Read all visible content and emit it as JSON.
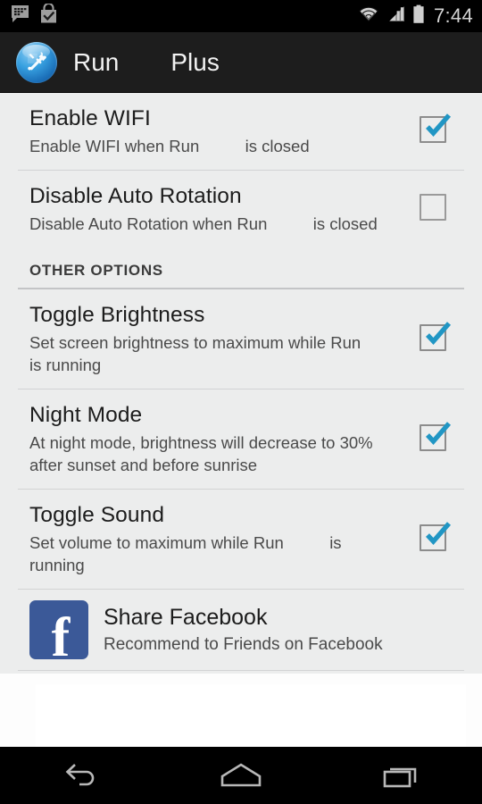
{
  "status_bar": {
    "time": "7:44",
    "left_icons": [
      "bbm-chat-icon",
      "play-store-bag-icon"
    ],
    "right_icons": [
      "wifi-icon",
      "cellular-signal-icon",
      "battery-icon"
    ]
  },
  "action_bar": {
    "app_icon": "wrench-tool-icon",
    "title": "Run",
    "title_secondary": "Plus"
  },
  "settings": {
    "rows": [
      {
        "title": "Enable WIFI",
        "summary": "Enable WIFI when Run          is closed",
        "checked": true
      },
      {
        "title": "Disable Auto Rotation",
        "summary": "Disable Auto Rotation when Run          is closed",
        "checked": false
      }
    ],
    "section_header": "OTHER OPTIONS",
    "other_rows": [
      {
        "title": "Toggle Brightness",
        "summary": "Set screen brightness to maximum while Run          is running",
        "checked": true
      },
      {
        "title": "Night Mode",
        "summary": "At night mode, brightness will decrease to 30% after sunset and before sunrise",
        "checked": true
      },
      {
        "title": "Toggle Sound",
        "summary": "Set volume to maximum while Run          is running",
        "checked": true
      }
    ],
    "facebook": {
      "icon": "facebook-icon",
      "title": "Share Facebook",
      "summary": "Recommend to Friends on Facebook"
    }
  },
  "nav_bar": {
    "back": "back-icon",
    "home": "home-icon",
    "recents": "recents-icon"
  },
  "colors": {
    "accent_check": "#2196c4",
    "facebook_blue": "#3b5998",
    "background": "#eceded",
    "action_bar": "#1d1d1d"
  }
}
